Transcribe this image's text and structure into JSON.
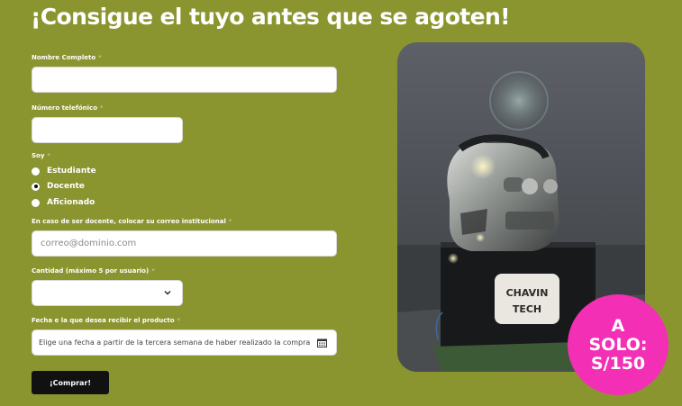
{
  "headline": "¡Consigue el tuyo antes que se agoten!",
  "form": {
    "name_label": "Nombre Completo",
    "phone_label": "Número telefónico",
    "role_label": "Soy",
    "role_options": [
      "Estudiante",
      "Docente",
      "Aficionado"
    ],
    "role_selected": "Docente",
    "email_label": "En caso de ser docente, colocar su correo institucional",
    "email_placeholder": "correo@dominio.com",
    "quantity_label": "Cantidad (máximo 5 por usuario)",
    "quantity_value": "",
    "date_label": "Fecha e la que desea recibir el producto",
    "date_placeholder": "Elige una fecha a partir de la tercera semana de haber realizado la compra",
    "required_mark": "*",
    "submit_label": "¡Comprar!"
  },
  "product_image": {
    "label_line1": "CHAVIN",
    "label_line2": "TECH"
  },
  "badge": {
    "text": "A\nSOLO:\nS/150"
  },
  "colors": {
    "background": "#8a952f",
    "badge": "#f22fb5",
    "button": "#111111"
  }
}
